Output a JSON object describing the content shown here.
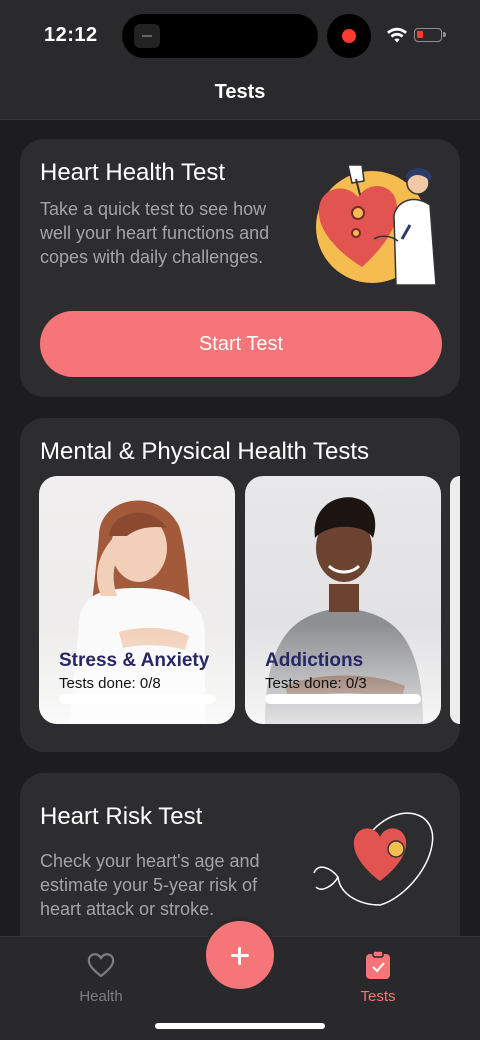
{
  "status_bar": {
    "time": "12:12",
    "battery_color": "#ff3b30"
  },
  "header": {
    "title": "Tests"
  },
  "heart_health": {
    "title": "Heart Health Test",
    "description": "Take a quick test to see how well your heart functions and copes with daily challenges.",
    "button_label": "Start Test"
  },
  "mental_physical": {
    "title": "Mental & Physical Health Tests",
    "tiles": [
      {
        "name": "Stress & Anxiety",
        "done_label": "Tests done: 0/8",
        "progress": 0
      },
      {
        "name": "Addictions",
        "done_label": "Tests done: 0/3",
        "progress": 0
      }
    ]
  },
  "heart_risk": {
    "title": "Heart Risk Test",
    "description": "Check your heart's age and estimate your 5-year risk of heart attack or stroke."
  },
  "tab_bar": {
    "tabs": [
      {
        "label": "Health",
        "icon": "heart-outline-icon",
        "active": false
      },
      {
        "label": "Tests",
        "icon": "clipboard-check-icon",
        "active": true
      }
    ],
    "fab_icon": "plus-icon"
  },
  "colors": {
    "accent": "#f57579",
    "background": "#1d1c1e",
    "card": "#2d2c2f",
    "tile_title": "#272763"
  }
}
